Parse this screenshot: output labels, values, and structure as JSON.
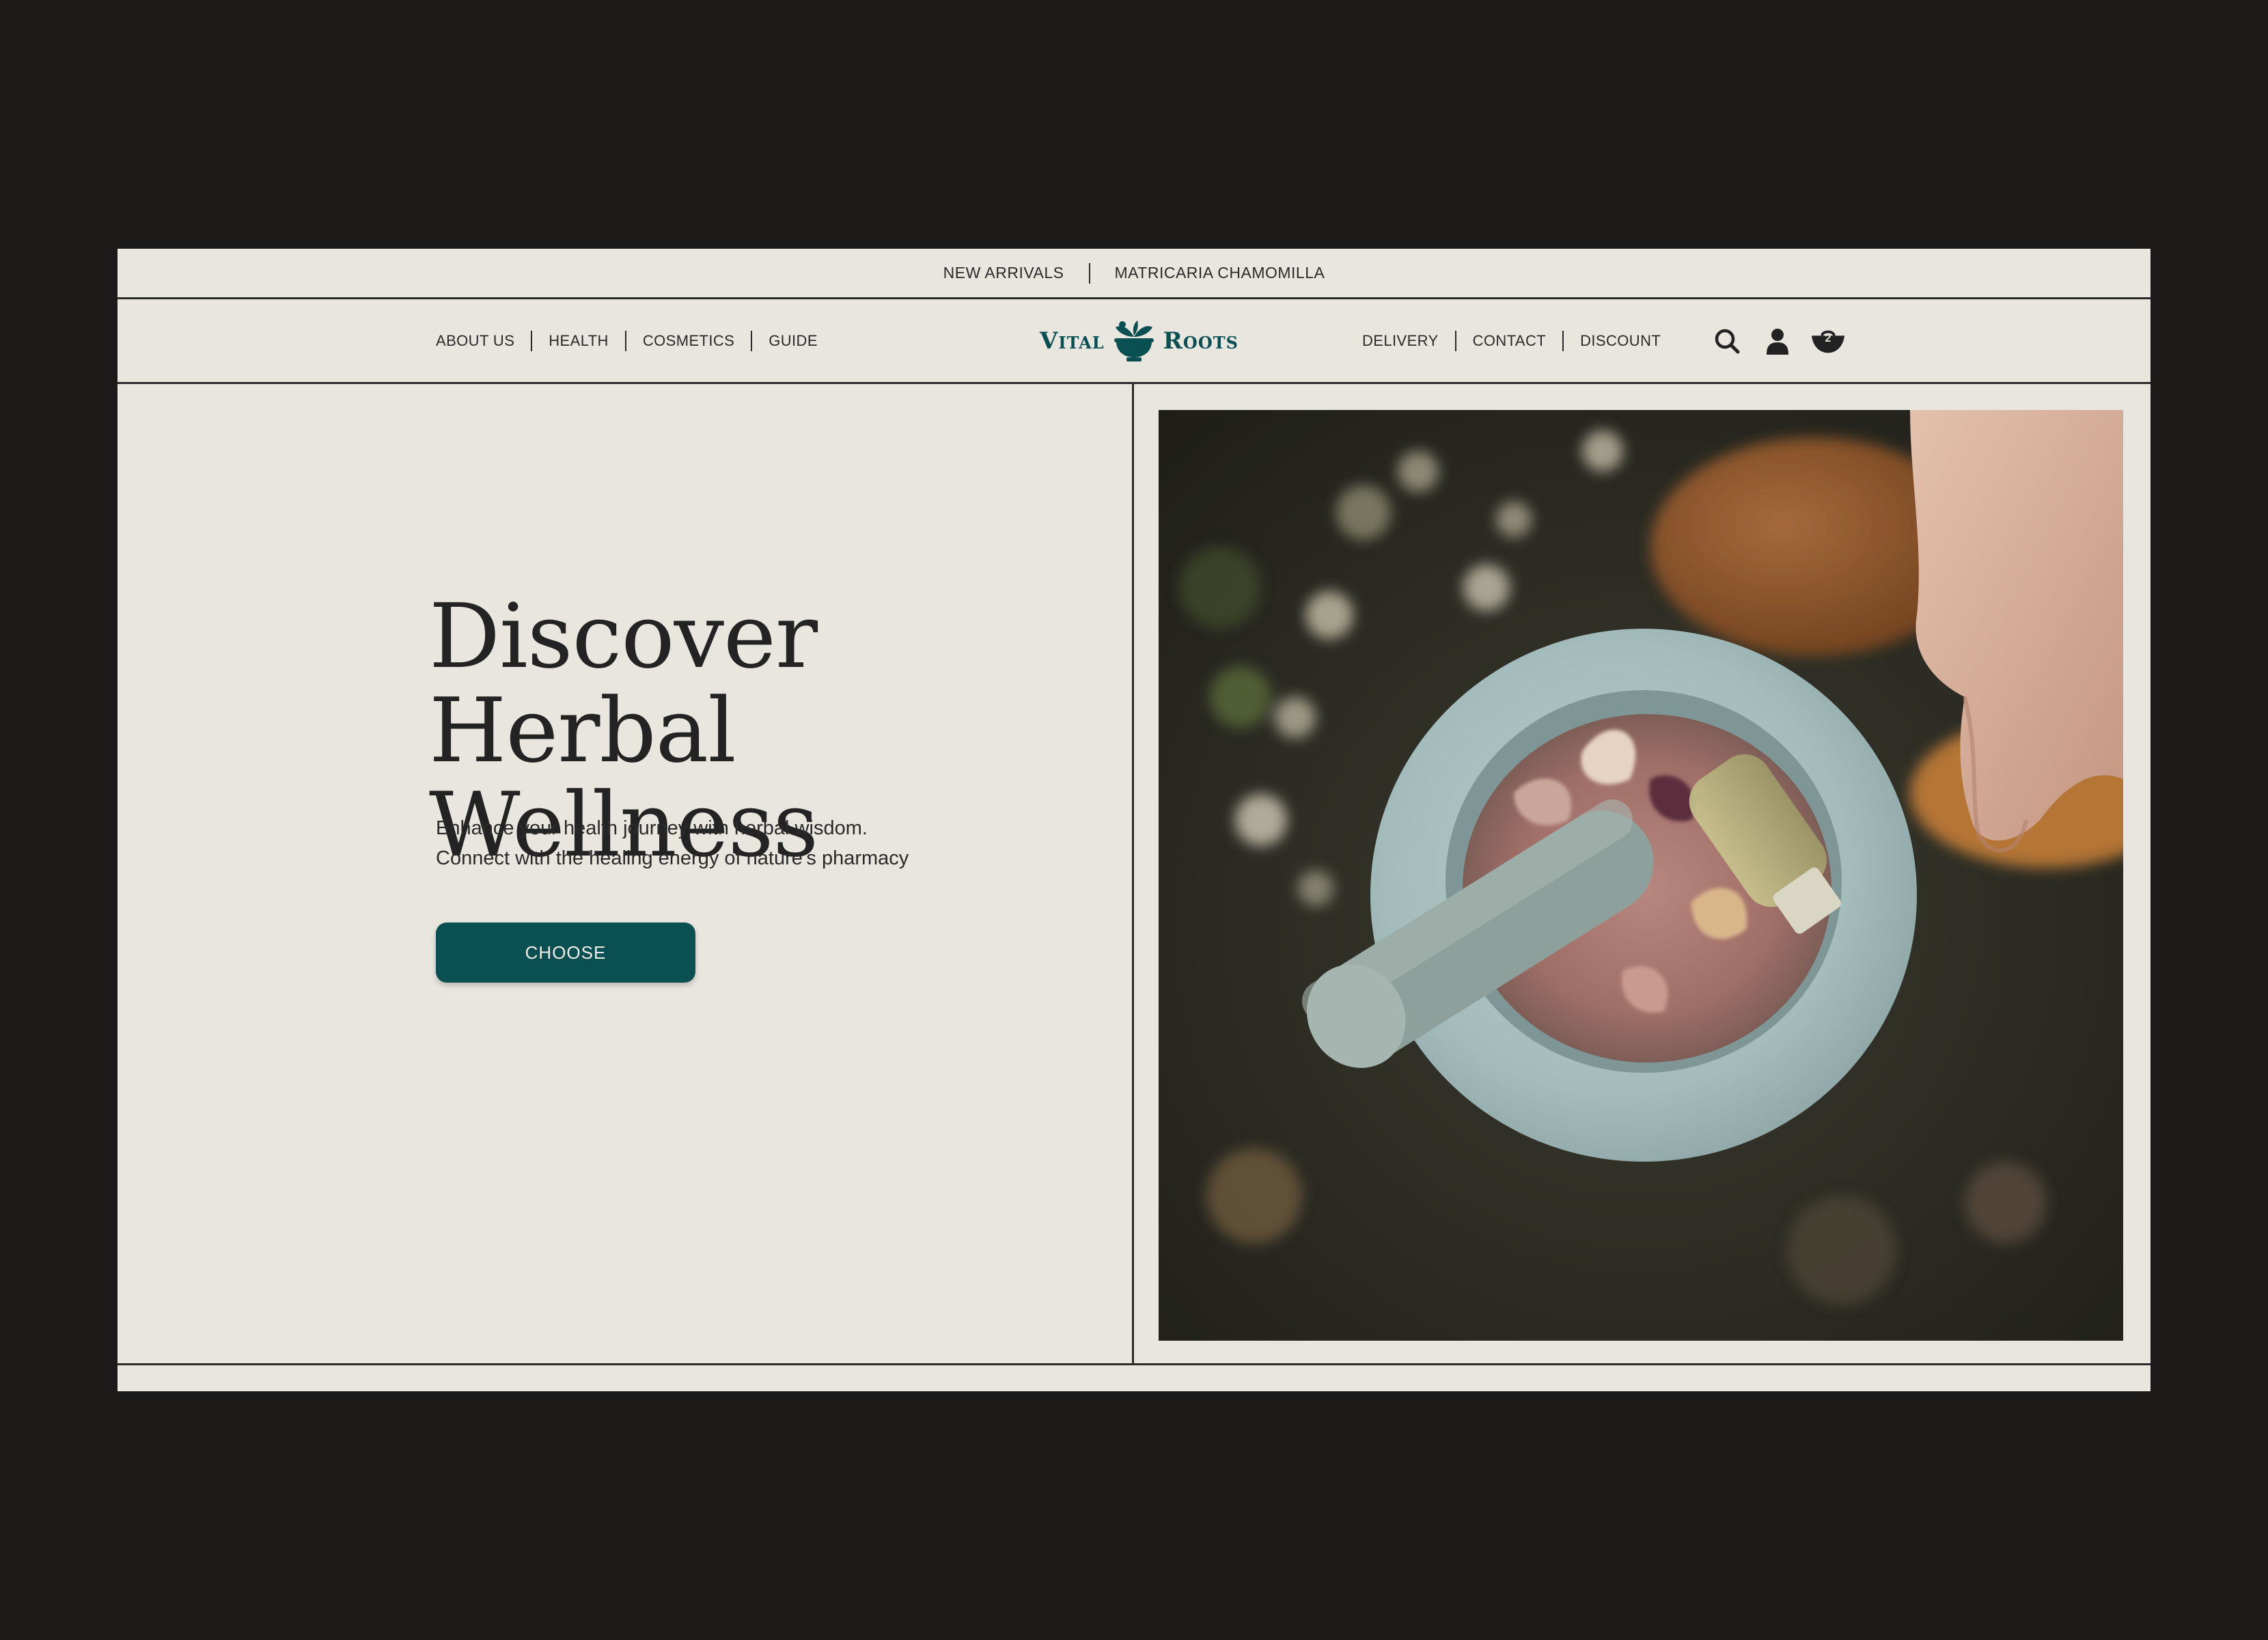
{
  "topbar": {
    "links": [
      "NEW ARRIVALS",
      "MATRICARIA CHAMOMILLA"
    ]
  },
  "nav": {
    "left_items": [
      "ABOUT US",
      "HEALTH",
      "COSMETICS",
      "GUIDE"
    ],
    "right_items": [
      "DELIVERY",
      "CONTACT",
      "DISCOUNT"
    ],
    "logo": {
      "word1": "Vital",
      "word2": "Roots"
    },
    "icons": [
      "search-icon",
      "user-icon",
      "cart-icon"
    ],
    "cart_count": "2"
  },
  "hero": {
    "title_line1": "Discover Herbal",
    "title_line2": "Wellness",
    "subtitle_line1": "Enhance your health journey with herbal wisdom.",
    "subtitle_line2": "Connect with the healing energy of nature's pharmacy",
    "cta_label": "CHOOSE"
  },
  "colors": {
    "background": "#e9e5df",
    "accent": "#0a4f51",
    "outer": "#1c1a18",
    "text": "#232323"
  }
}
